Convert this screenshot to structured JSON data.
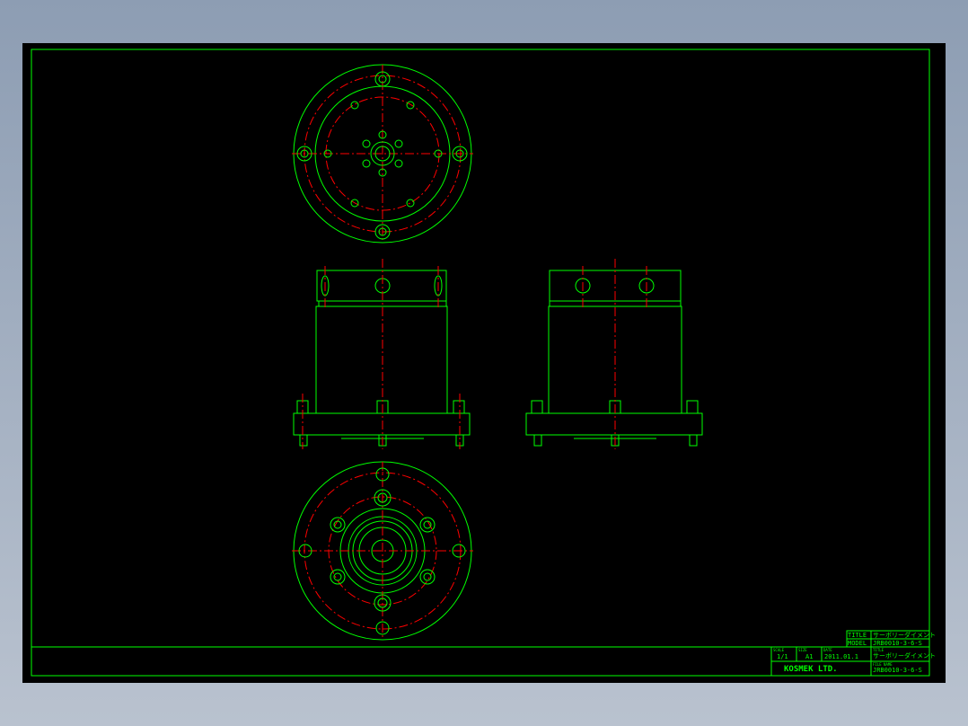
{
  "title_block": {
    "title_label": "TITLE",
    "title_value": "サーボリーダイメント",
    "model_label": "MODEL",
    "model_value": "JRB0010-3-6-S",
    "scale_label": "SCALE",
    "scale_value": "1/1",
    "size_label": "SIZE",
    "size_value": "A1",
    "date_label": "DATE",
    "date_value": "2011.01.1",
    "title2_label": "TITLE",
    "title2_value": "サーボリーダイメント",
    "filename_label": "FILE NAME",
    "filename_value": "JRB0010-3-6-S",
    "company": "KOSMEK LTD."
  },
  "colors": {
    "outline": "#00ff00",
    "centerline": "#ff0000",
    "background": "#000000"
  }
}
